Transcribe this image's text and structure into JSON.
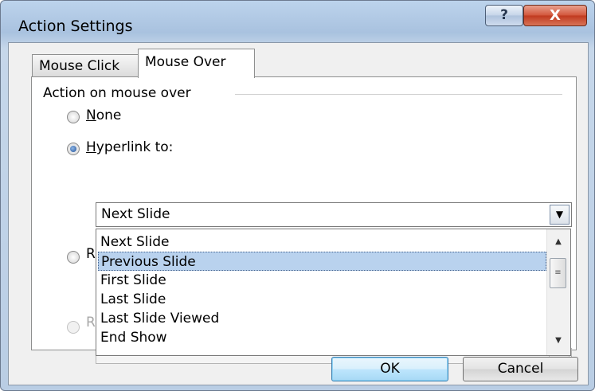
{
  "window": {
    "title": "Action Settings",
    "help_label": "?",
    "close_label": "X"
  },
  "tabs": [
    {
      "label": "Mouse Click",
      "active": false
    },
    {
      "label": "Mouse Over",
      "active": true
    }
  ],
  "group": {
    "label": "Action on mouse over"
  },
  "options": {
    "none": {
      "label_first": "N",
      "label_rest": "one",
      "checked": false
    },
    "hyperlink": {
      "label_first": "H",
      "label_rest": "yperlink to:",
      "checked": true
    },
    "run_program": {
      "label": "R",
      "checked": false
    },
    "run_macro": {
      "label": "R",
      "checked": false,
      "disabled": true
    }
  },
  "hyperlink_combo": {
    "value": "Next Slide",
    "items": [
      "Next Slide",
      "Previous Slide",
      "First Slide",
      "Last Slide",
      "Last Slide Viewed",
      "End Show"
    ],
    "highlighted_index": 1
  },
  "buttons": {
    "ok": "OK",
    "cancel": "Cancel"
  },
  "icons": {
    "dropdown": "chevron-down-icon",
    "scroll_up": "scroll-up-icon",
    "scroll_down": "scroll-down-icon"
  }
}
